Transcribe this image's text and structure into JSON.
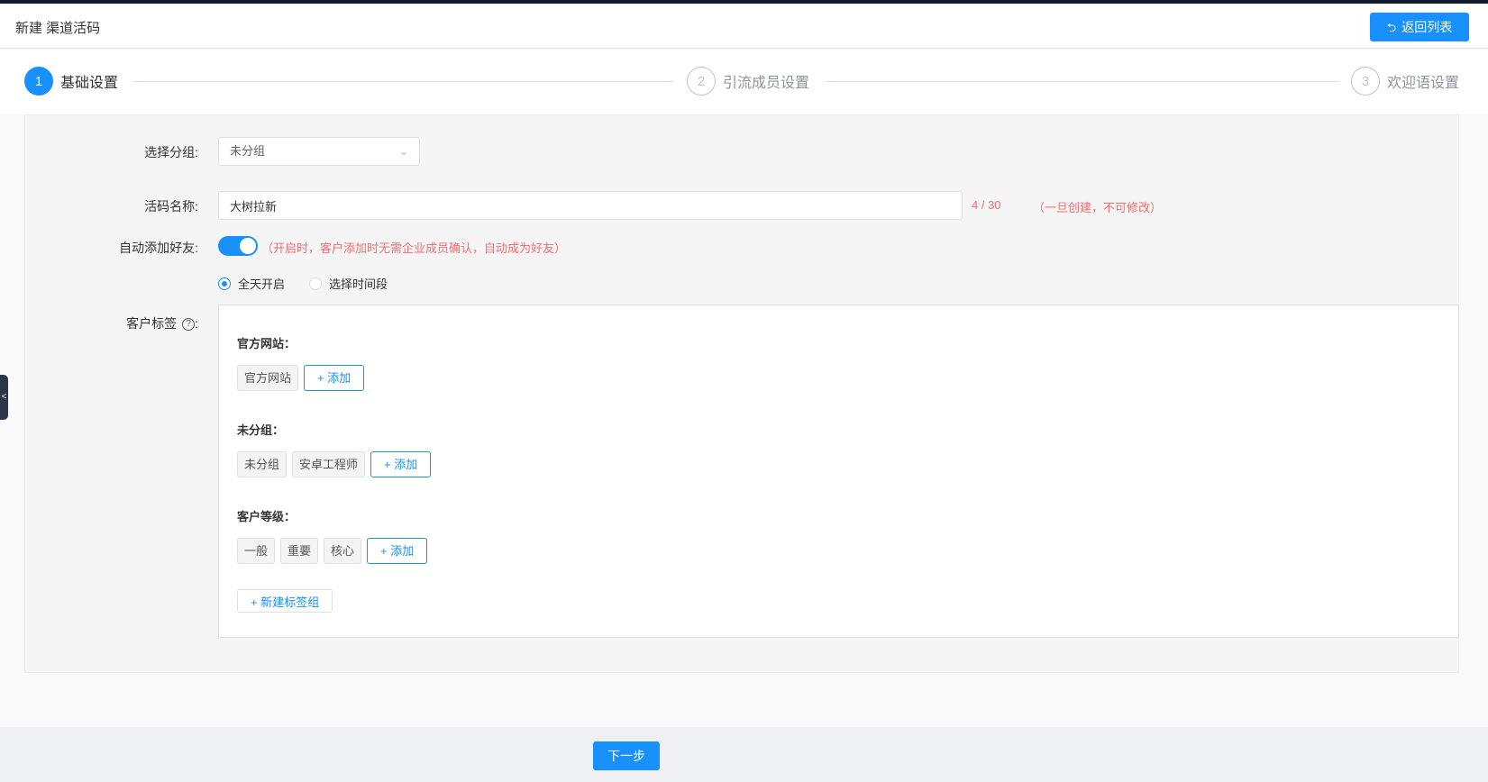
{
  "header": {
    "title": "新建 渠道活码",
    "back_label": "返回列表",
    "back_icon": "return-icon"
  },
  "steps": [
    {
      "number": "1",
      "label": "基础设置",
      "active": true
    },
    {
      "number": "2",
      "label": "引流成员设置",
      "active": false
    },
    {
      "number": "3",
      "label": "欢迎语设置",
      "active": false
    }
  ],
  "form": {
    "group_label": "选择分组:",
    "group_value": "未分组",
    "name_label": "活码名称:",
    "name_value": "大树拉新",
    "name_counter": "4 / 30",
    "name_hint": "（一旦创建，不可修改）",
    "auto_add_label": "自动添加好友:",
    "auto_add_on": true,
    "auto_add_hint": "（开启时，客户添加时无需企业成员确认，自动成为好友）",
    "time_options": [
      "全天开启",
      "选择时间段"
    ],
    "time_selected": "全天开启",
    "tags_label": "客户标签",
    "tags_label_suffix": ":",
    "help_icon": "?"
  },
  "tag_groups": [
    {
      "title": "官方网站：",
      "tags": [
        "官方网站"
      ],
      "add_label": "添加"
    },
    {
      "title": "未分组：",
      "tags": [
        "未分组",
        "安卓工程师"
      ],
      "add_label": "添加"
    },
    {
      "title": "客户等级：",
      "tags": [
        "一般",
        "重要",
        "核心"
      ],
      "add_label": "添加"
    }
  ],
  "new_group_label": "新建标签组",
  "plus": "+",
  "footer": {
    "next_label": "下一步"
  },
  "colors": {
    "primary": "#1890ff",
    "danger": "#f56c6c"
  }
}
